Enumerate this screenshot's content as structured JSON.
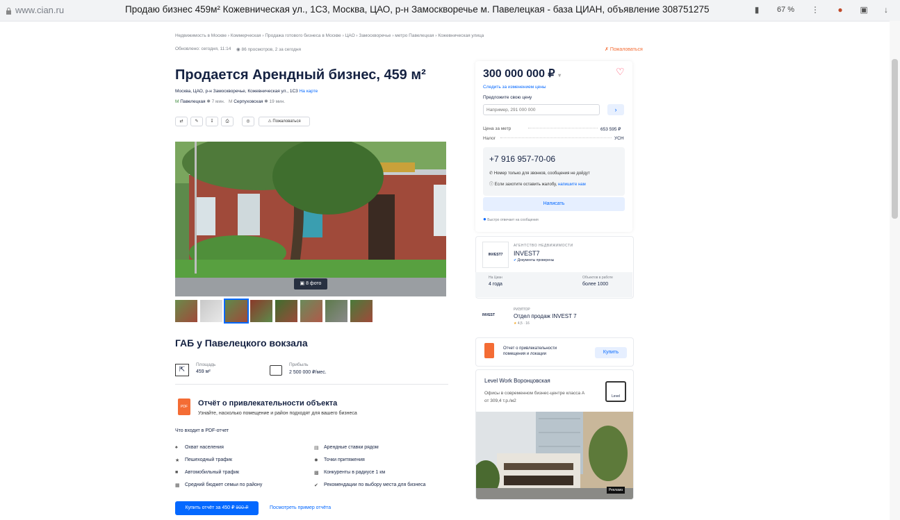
{
  "browser": {
    "url": "www.cian.ru",
    "tab_title": "Продаю бизнес 459м² Кожевническая ул., 1С3, Москва, ЦАО, р-н Замоскворечье м. Павелецкая - база ЦИАН, объявление 308751275",
    "zoom": "67 %"
  },
  "breadcrumbs": "Недвижимость в Москве  ›  Коммерческая  ›  Продажа готового бизнеса в Москве  ›  ЦАО  ›  Замоскворечье  ›  метро Павелецкая  ›  Кожевническая улица",
  "updated": "Обновлено: сегодня, 11:14",
  "views": "86 просмотров, 2 за сегодня",
  "complain": "Пожаловаться",
  "title": "Продается Арендный бизнес, 459 м²",
  "address": "Москва, ЦАО, р-н Замоскворечье, Кожевническая ул., 1С3",
  "map_link": "На карте",
  "metro1": "Павелецкая",
  "metro1_time": "7 мин.",
  "metro2": "Серпуховская",
  "metro2_time": "19 мин.",
  "report_button": "Пожаловаться",
  "photo_count": "8 фото",
  "subtitle": "ГАБ у Павелецкого вокзала",
  "area_label": "Площадь",
  "area_value": "459 м²",
  "profit_label": "Прибыль",
  "profit_value": "2 500 000 ₽/мес.",
  "report": {
    "title": "Отчёт о привлекательности объекта",
    "desc": "Узнайте, насколько помещение и район подходят для вашего бизнеса",
    "includes": "Что входит в PDF-отчет",
    "items_left": [
      "Охват населения",
      "Пешеходный трафик",
      "Автомобильный трафик",
      "Средний бюджет семьи по району"
    ],
    "items_right": [
      "Арендные ставки рядом",
      "Точки притяжения",
      "Конкуренты в радиусе 1 км",
      "Рекомендации по выбору места для бизнеса"
    ],
    "buy": "Купить отчёт за 450 ₽",
    "buy_old": "900 ₽",
    "example": "Посмотреть пример отчёта"
  },
  "side": {
    "price": "300 000 000 ₽",
    "follow": "Следить за изменением цены",
    "offer": "Предложите свою цену",
    "offer_placeholder": "Например, 291 000 000",
    "per_meter_label": "Цена за метр",
    "per_meter_value": "653 595 ₽",
    "tax_label": "Налог",
    "tax_value": "УСН",
    "phone": "+7 916 957-70-06",
    "phone_note": "Номер только для звонков, сообщения не дойдут",
    "complaint_note": "Если захотите оставить жалобу,",
    "complaint_link": "напишите нам",
    "write": "Написать",
    "online": "Быстро отвечает на сообщения",
    "agency_type": "АГЕНТСТВО НЕДВИЖИМОСТИ",
    "agency_name": "INVEST7",
    "agency_logo": "INVEST7",
    "agency_docs": "Документы проверены",
    "on_cian_label": "На Циан",
    "on_cian_value": "4 года",
    "objects_label": "Объектов в работе",
    "objects_value": "более 1000",
    "realtor_type": "РИЭЛТОР",
    "realtor_logo": "INVEST",
    "realtor_name": "Отдел продаж INVEST 7",
    "realtor_rating": "4,5 · 16",
    "promo_title": "Отчет о привлекательности помещения и локации",
    "promo_buy": "Купить",
    "ad_title": "Level Work Воронцовская",
    "ad_desc": "Офисы в современном бизнес-центре класса А от 309,4 т.р./м2",
    "ad_logo": "Level",
    "ad_badge": "Реклама"
  },
  "colors": {
    "accent": "#0468ff",
    "text": "#152242",
    "muted": "#7a7f87",
    "heart": "#ff3b5c",
    "promo": "#f46c34"
  }
}
